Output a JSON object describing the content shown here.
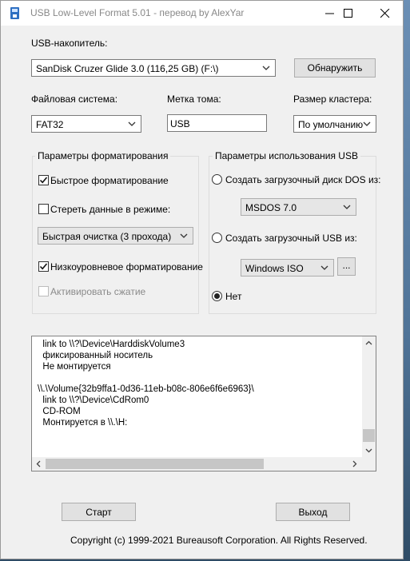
{
  "window": {
    "title": "USB Low-Level Format 5.01 - перевод by AlexYar",
    "icons": [
      "app-icon",
      "minimize-icon",
      "maximize-icon",
      "close-icon"
    ]
  },
  "drive": {
    "label": "USB-накопитель:",
    "selected": "SanDisk Cruzer Glide 3.0 (116,25 GB) (F:\\)",
    "detect_button": "Обнаружить"
  },
  "filesystem": {
    "label": "Файловая система:",
    "selected": "FAT32"
  },
  "volume": {
    "label": "Метка тома:",
    "value": "USB"
  },
  "cluster": {
    "label": "Размер кластера:",
    "selected": "По умолчанию"
  },
  "format_params": {
    "title": "Параметры форматирования",
    "quick_format": {
      "label": "Быстрое форматирование",
      "checked": true
    },
    "erase_mode": {
      "label": "Стереть данные в режиме:",
      "checked": false
    },
    "erase_mode_select": "Быстрая очистка (3 прохода)",
    "low_level": {
      "label": "Низкоуровневое форматирование",
      "checked": true
    },
    "compression": {
      "label": "Активировать сжатие",
      "checked": false,
      "disabled": true
    }
  },
  "usb_params": {
    "title": "Параметры использования USB",
    "dos_boot": {
      "label": "Создать загрузочный диск DOS из:",
      "selected": false
    },
    "dos_select": "MSDOS 7.0",
    "usb_boot": {
      "label": "Создать загрузочный USB из:",
      "selected": false
    },
    "usb_select": "Windows ISO",
    "browse_button": "...",
    "none": {
      "label": "Нет",
      "selected": true
    }
  },
  "log": {
    "lines": [
      "  link to \\\\?\\Device\\HarddiskVolume3",
      "  фиксированный носитель",
      "  Не монтируется",
      "",
      "\\\\.\\Volume{32b9ffa1-0d36-11eb-b08c-806e6f6e6963}\\",
      "  link to \\\\?\\Device\\CdRom0",
      "  CD-ROM",
      "  Монтируется в \\\\.\\H:"
    ]
  },
  "footer": {
    "start_button": "Старт",
    "exit_button": "Выход",
    "copyright": "Copyright (c) 1999-2021 Bureausoft Corporation. All Rights Reserved."
  }
}
